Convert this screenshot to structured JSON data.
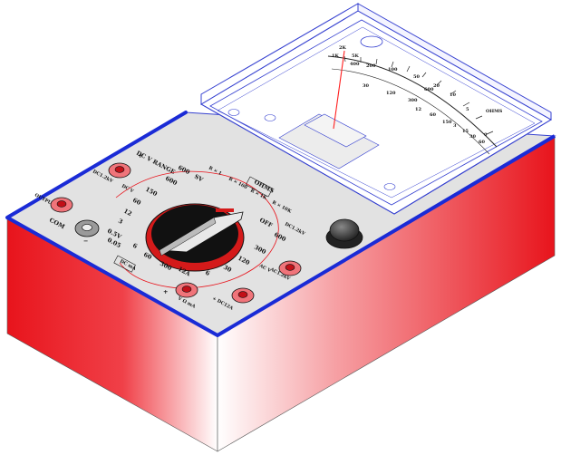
{
  "colors": {
    "body_red": "#e8141c",
    "body_red_light": "#ffffff",
    "edge_blue": "#1a2bd6",
    "panel_grey": "#e2e2e2",
    "meter_window": "#ffffff",
    "outline": "#3540d0",
    "jack_red": "#f0747a",
    "knob_dark": "#333333",
    "dial_red": "#d41a1a",
    "needle_red": "#ff2020"
  },
  "meter": {
    "scale_labels": [
      "2K",
      "5K",
      "1K",
      "400",
      "200",
      "100",
      "50",
      "20",
      "10",
      "5",
      "0",
      "OHMS",
      "30",
      "120",
      "300",
      "12",
      "60",
      "150",
      "600",
      "3",
      "15",
      "30",
      "60"
    ]
  },
  "panel_labels": {
    "dcv_range": "DC V RANGE",
    "ohms_box": "OHMS",
    "rx": [
      "R × 1",
      "R × 100",
      "R × 1K",
      "R × 10K"
    ],
    "dc_v_tag": "DC V",
    "dc_ma_tag": "DC mA",
    "ac_v_tag": "AC V",
    "output": "OUTPUT",
    "com": "COM",
    "off": "OFF",
    "dc12kv": "DC1.2kV",
    "ac12kv": "AC1.2kV",
    "vmadc": "V Ω mA",
    "dc12a": "+ DC12A",
    "plus": "+",
    "minus": "−",
    "dial_values_left": [
      "600",
      "150",
      "60",
      "12",
      "3",
      "0.5V",
      "0.05"
    ],
    "dial_values_bottom": [
      "6",
      "60",
      "300",
      "12A"
    ],
    "dial_values_right": [
      "600",
      "300",
      "120",
      "30",
      "6"
    ],
    "dial_top": [
      "SV",
      "600",
      "150"
    ]
  }
}
